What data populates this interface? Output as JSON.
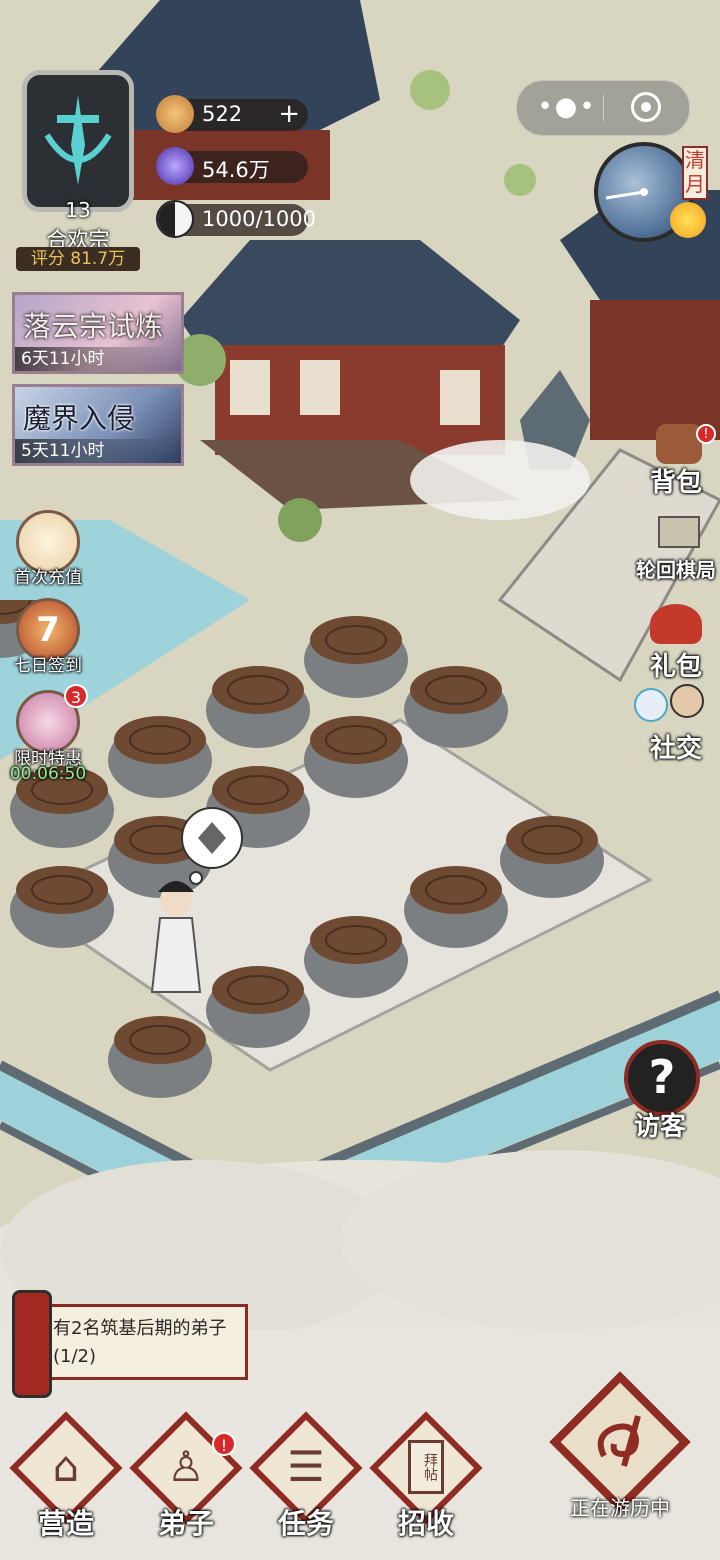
{
  "hud": {
    "sect_level": "13",
    "sect_name": "合欢宗",
    "sect_score": "评分 81.7万",
    "resources": [
      {
        "icon": "spirit-beast-icon",
        "value": "522",
        "has_plus": true
      },
      {
        "icon": "spirit-crystal-icon",
        "value": "54.6万",
        "has_plus": false
      },
      {
        "icon": "yin-yang-icon",
        "value": "1000/1000",
        "has_plus": false
      }
    ]
  },
  "events": [
    {
      "title": "落云宗试炼",
      "timer": "6天11小时"
    },
    {
      "title": "魔界入侵",
      "timer": "5天11小时"
    }
  ],
  "left_menu": [
    {
      "label": "首次充值",
      "icon": "first-recharge-icon"
    },
    {
      "label": "七日签到",
      "icon": "seven-day-signin-icon",
      "glyph": "7"
    },
    {
      "label": "限时特惠",
      "icon": "limited-offer-icon",
      "badge": "3",
      "timer": "00:06:50"
    }
  ],
  "clock": {
    "label": "清月",
    "icon": "sun-icon"
  },
  "right_menu": [
    {
      "label": "背包",
      "icon": "backpack-icon"
    },
    {
      "label": "轮回棋局",
      "icon": "chess-board-icon"
    },
    {
      "label": "礼包",
      "icon": "gift-pack-icon"
    },
    {
      "label": "社交",
      "icon": "social-icon"
    }
  ],
  "visitor": {
    "label": "访客",
    "glyph": "?"
  },
  "quest": {
    "text": "有2名筑基后期的弟子(1/2)"
  },
  "bottom_nav": [
    {
      "label": "营造",
      "icon": "build-icon"
    },
    {
      "label": "弟子",
      "icon": "disciples-icon"
    },
    {
      "label": "任务",
      "icon": "tasks-icon"
    },
    {
      "label": "招收",
      "icon": "recruit-icon",
      "card_text": "拜帖"
    }
  ],
  "travel": {
    "label": "正在游历中"
  },
  "colors": {
    "accent_red": "#8e2b22",
    "paper": "#f4eedf",
    "gold": "#e8c25a"
  }
}
